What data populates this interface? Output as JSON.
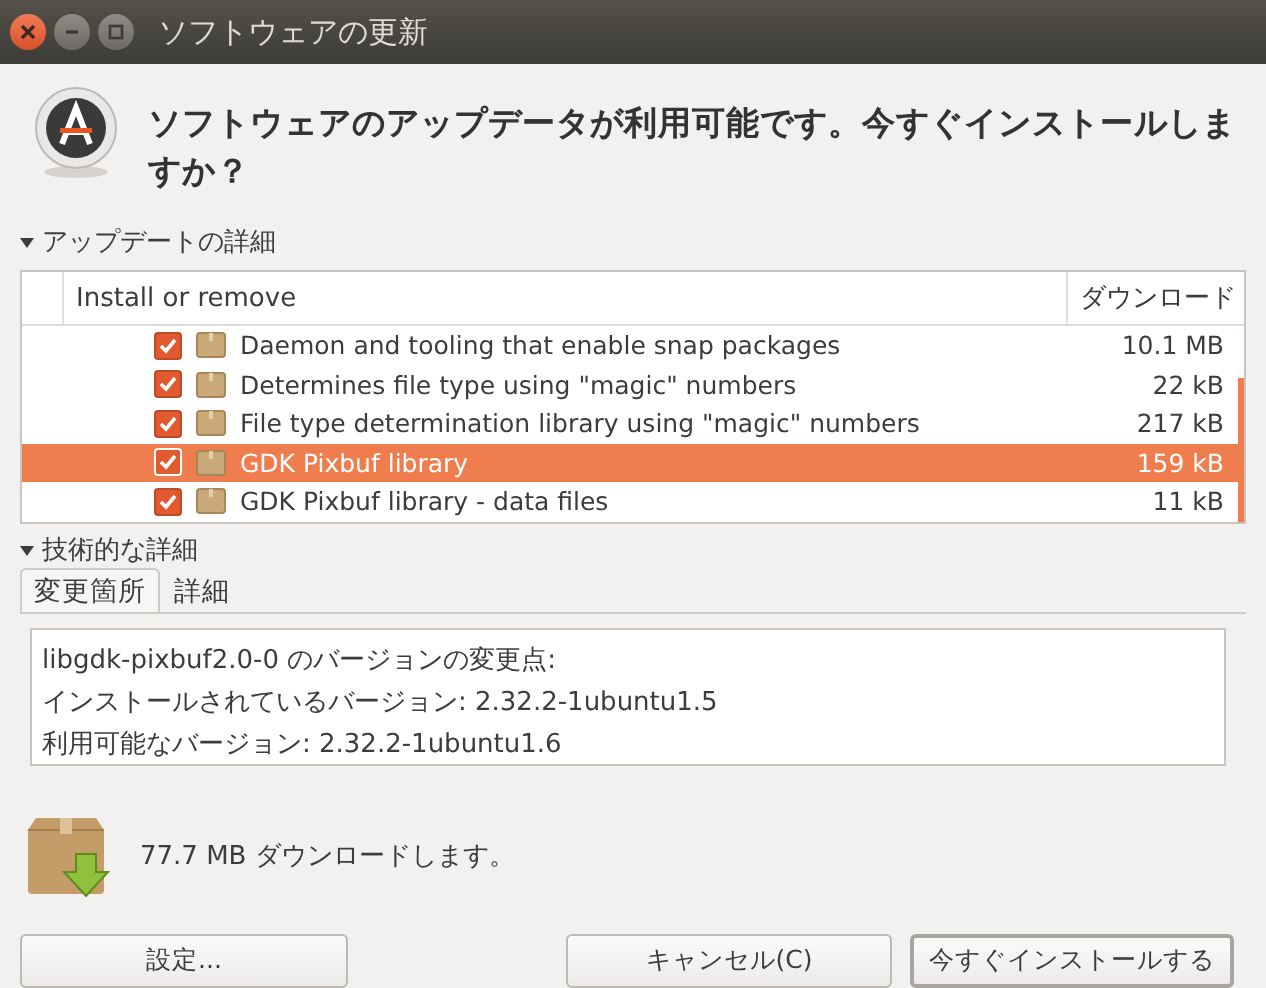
{
  "window": {
    "title": "ソフトウェアの更新"
  },
  "heading": "ソフトウェアのアップデータが利用可能です。今すぐインストールしますか？",
  "updates_expander": {
    "label": "アップデートの詳細",
    "expanded": true
  },
  "table": {
    "columns": [
      "Install or remove",
      "ダウンロード"
    ],
    "rows": [
      {
        "name": "Daemon and tooling that enable snap packages",
        "size": "10.1 MB",
        "checked": true,
        "selected": false
      },
      {
        "name": "Determines file type using \"magic\" numbers",
        "size": "22 kB",
        "checked": true,
        "selected": false
      },
      {
        "name": "File type determination library using \"magic\" numbers",
        "size": "217 kB",
        "checked": true,
        "selected": false
      },
      {
        "name": "GDK Pixbuf library",
        "size": "159 kB",
        "checked": true,
        "selected": true
      },
      {
        "name": "GDK Pixbuf library - data files",
        "size": "11 kB",
        "checked": true,
        "selected": false
      }
    ]
  },
  "technical_expander": {
    "label": "技術的な詳細",
    "expanded": true
  },
  "tabs": [
    {
      "label": "変更箇所",
      "selected": true
    },
    {
      "label": "詳細",
      "selected": false
    }
  ],
  "changes": [
    "libgdk-pixbuf2.0-0 のバージョンの変更点:",
    "インストールされているバージョン: 2.32.2-1ubuntu1.5",
    "利用可能なバージョン: 2.32.2-1ubuntu1.6"
  ],
  "download_summary": "77.7 MB ダウンロードします。",
  "buttons": [
    {
      "label": "設定...",
      "kind": "normal"
    },
    {
      "label": "キャンセル(C)",
      "kind": "normal"
    },
    {
      "label": "今すぐインストールする",
      "kind": "default"
    }
  ]
}
